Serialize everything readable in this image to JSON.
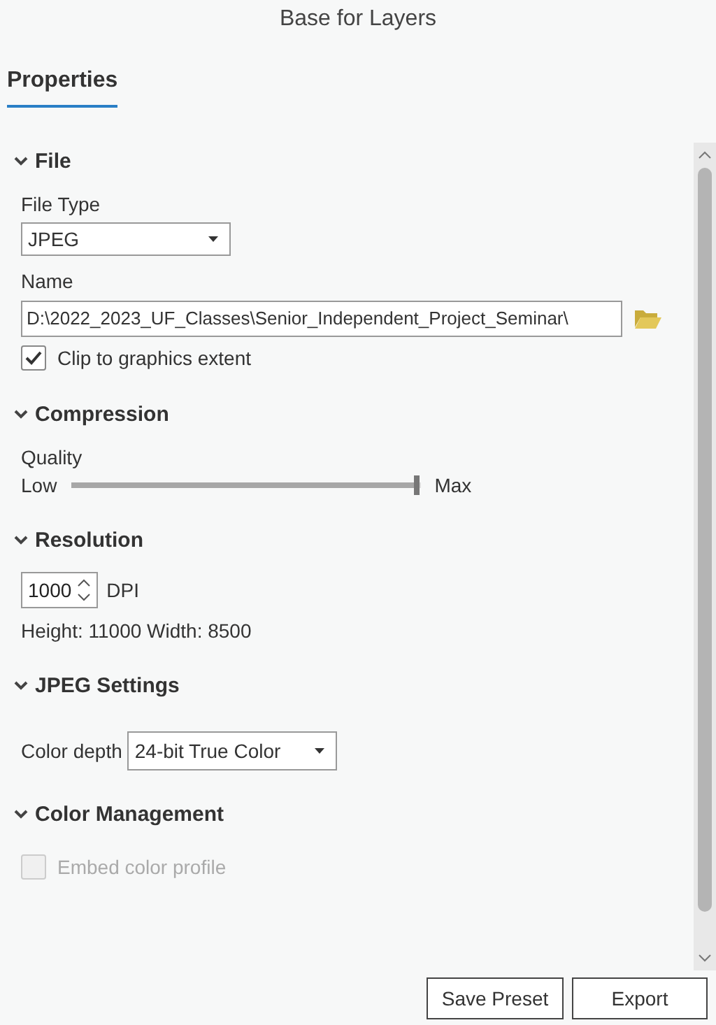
{
  "window": {
    "title": "Base for Layers"
  },
  "tabs": [
    {
      "label": "Properties",
      "selected": true
    }
  ],
  "sections": [
    {
      "kind": "file",
      "heading": "File",
      "expanded": true,
      "file_type_label": "File Type",
      "file_type_value": "JPEG",
      "name_label": "Name",
      "name_value": "D:\\2022_2023_UF_Classes\\Senior_Independent_Project_Seminar\\",
      "clip": {
        "label": "Clip to graphics extent",
        "checked": true,
        "disabled": false
      }
    },
    {
      "kind": "compression",
      "heading": "Compression",
      "expanded": true,
      "quality_label": "Quality",
      "low_label": "Low",
      "max_label": "Max",
      "level": 0.99
    },
    {
      "kind": "resolution",
      "heading": "Resolution",
      "expanded": true,
      "dpi_value": "1000",
      "dpi_unit": "DPI",
      "size_text": "Height: 11000 Width: 8500"
    },
    {
      "kind": "jpeg",
      "heading": "JPEG Settings",
      "expanded": true,
      "depth_label": "Color depth",
      "depth_value": "24-bit True Color"
    },
    {
      "kind": "color",
      "heading": "Color Management",
      "expanded": true,
      "embed": {
        "label": "Embed color profile",
        "checked": false,
        "disabled": true
      }
    }
  ],
  "buttons": [
    "Save Preset",
    "Export"
  ]
}
